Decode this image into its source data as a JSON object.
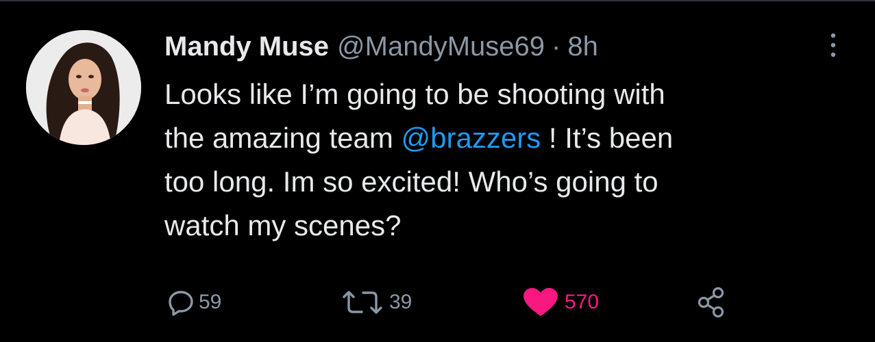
{
  "tweet": {
    "author": {
      "display_name": "Mandy Muse",
      "handle": "@MandyMuse69",
      "separator": "·",
      "time_ago": "8h"
    },
    "text": {
      "line1": "Looks like I’m going to be shooting with",
      "line2_before": "the amazing team ",
      "line2_mention": "@brazzers",
      "line2_after": " ! It’s been",
      "line3": "too long. Im so excited! Who’s going to",
      "line4": "watch my scenes?"
    },
    "actions": {
      "reply_count": "59",
      "retweet_count": "39",
      "like_count": "570",
      "reply_icon": "reply-icon",
      "retweet_icon": "retweet-icon",
      "like_icon": "heart-icon",
      "share_icon": "share-icon",
      "more_icon": "more-vertical-icon"
    },
    "colors": {
      "background": "#000000",
      "text": "#e7e9ea",
      "muted": "#8b98a5",
      "mention": "#1d9bf0",
      "like": "#f91880"
    }
  }
}
